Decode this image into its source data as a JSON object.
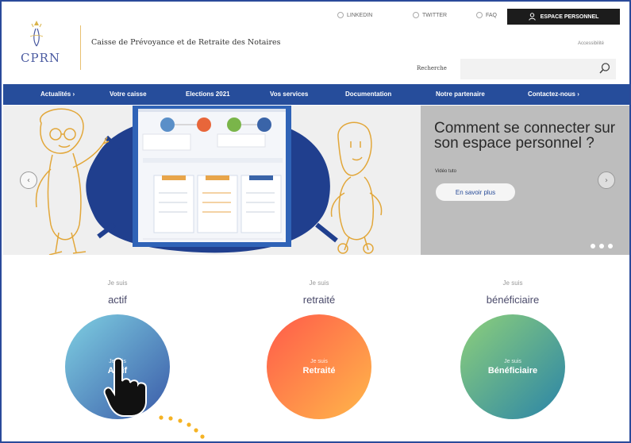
{
  "header": {
    "logo_text": "CPRN",
    "org_name": "Caisse de Prévoyance et de Retraite des Notaires",
    "top_links": [
      "LINKEDIN",
      "TWITTER",
      "FAQ"
    ],
    "espace_btn": "ESPACE PERSONNEL",
    "accessibility": "Accessibilité",
    "search_label": "Recherche",
    "search_placeholder": ""
  },
  "nav": {
    "items": [
      "Actualités ›",
      "Votre caisse",
      "Elections 2021",
      "Vos services",
      "Documentation",
      "Notre partenaire",
      "Contactez-nous ›"
    ]
  },
  "banner": {
    "title": "Comment se connecter sur son espace personnel ?",
    "subtitle": "Vidéo tuto",
    "button": "En savoir plus",
    "prev": "‹",
    "next": "›"
  },
  "profiles": [
    {
      "pre": "Je suis",
      "title": "actif",
      "circle_pre": "Je suis",
      "circle_label": "Actif",
      "color_a": "#7fd0e2",
      "color_b": "#3a5aa8"
    },
    {
      "pre": "Je suis",
      "title": "retraité",
      "circle_pre": "Je suis",
      "circle_label": "Retraité",
      "color_a": "#ff5a4a",
      "color_b": "#ffb84a"
    },
    {
      "pre": "Je suis",
      "title": "bénéficiaire",
      "circle_pre": "Je suis",
      "circle_label": "Bénéficiaire",
      "color_a": "#8ed07a",
      "color_b": "#2a84a8"
    }
  ],
  "colors": {
    "nav": "#264d9b",
    "brand": "#4a5aa0",
    "accent_dots": "#f5b324"
  }
}
